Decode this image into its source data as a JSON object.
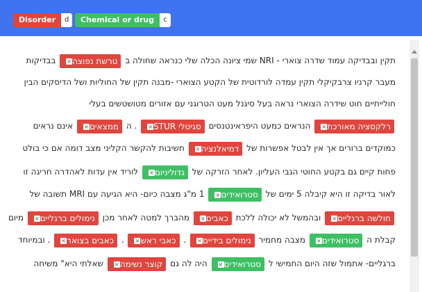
{
  "labels": [
    {
      "name": "Disorder",
      "key": "d",
      "color": "#e0453e"
    },
    {
      "name": "Chemical or drug",
      "key": "c",
      "color": "#3fbf64"
    }
  ],
  "entity_remove_glyph": "×",
  "lines": [
    [
      {
        "t": "תקין ובבדיקה עמוד שדרה צוארי - NRI שמי ציונה הכלה שלי כנראה שחולה ב"
      },
      {
        "e": "טרשת נפוצה",
        "c": "red"
      },
      {
        "t": "בבדיקות"
      }
    ],
    [
      {
        "t": "מעבר קרניו צרבקיקלי תקין עמדה לורדוטית של הקטע הצוארי -מבנה תקין של החוליות ושל הדיסקים הבין"
      }
    ],
    [
      {
        "t": "חולייתיים חוט שידרה הצוארי נראה בעל סיגנל מעט הטרוגני עם אזורים מטושטשים בעלי"
      }
    ],
    [
      {
        "e": "רלקסציה מאורכת",
        "c": "red"
      },
      {
        "t": "הנראים כמעט היפראינטנסים"
      },
      {
        "e": "סגיטלי STUR",
        "c": "red"
      },
      {
        "t": ". ה"
      },
      {
        "e": "ממצאים",
        "c": "red"
      },
      {
        "t": "אינם נראים"
      }
    ],
    [
      {
        "t": "כמוקדים ברורים אך אין לבטל אפשרות של"
      },
      {
        "e": "דמיאלנציה",
        "c": "red"
      },
      {
        "t": "חשיבות להקשר הקליני מצב דומה אם כי בולט"
      }
    ],
    [
      {
        "t": "פחות קיים גם בקטע החוטי הגבי העליון. לאחר הזרקה של"
      },
      {
        "e": "גדוליניום",
        "c": "green"
      },
      {
        "t": "לוריד אין עדות לאהדרה חריגה זו"
      }
    ],
    [
      {
        "t": "לאור בדיקה זו היא קיבלה 5 ימים של"
      },
      {
        "e": "סטרואידים",
        "c": "green"
      },
      {
        "t": "1 מ\"ג מצבה כיום- היא הגיעה עם MRI תשובה של"
      }
    ],
    [
      {
        "e": "חולשה ברגליים",
        "c": "red"
      },
      {
        "t": "ובהמשל לא יכולה ללכת"
      },
      {
        "e": "כאבים",
        "c": "red"
      },
      {
        "t": "מהברך למטה לאחר מכן"
      },
      {
        "e": "נימולים ברגליים",
        "c": "red"
      },
      {
        "t": "מיום"
      }
    ],
    [
      {
        "t": "קבלת ה"
      },
      {
        "e": "סטרואידים",
        "c": "green"
      },
      {
        "t": "מצבה מחמיר"
      },
      {
        "e": "נימולים בידיים",
        "c": "red"
      },
      {
        "t": "."
      },
      {
        "e": "כאבי ראש",
        "c": "red"
      },
      {
        "t": "."
      },
      {
        "e": "כאבים בצואר",
        "c": "red"
      },
      {
        "t": ". ובמיוחד"
      }
    ],
    [
      {
        "t": "ברגליים- אתמול שזה היום החמישי ל"
      },
      {
        "e": "סטרואידים",
        "c": "green"
      },
      {
        "t": "היה לה גם"
      },
      {
        "e": "קוצר נשימה",
        "c": "red"
      },
      {
        "t": "שאלתי היא\" משיחה"
      }
    ]
  ]
}
